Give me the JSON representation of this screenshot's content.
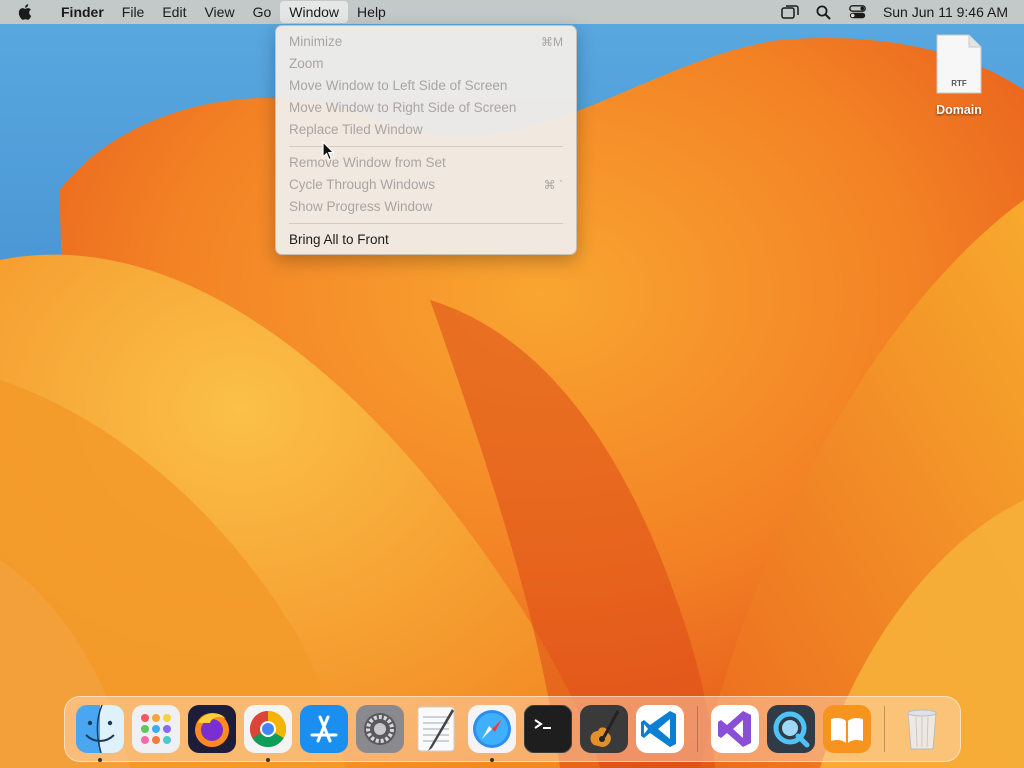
{
  "menubar": {
    "app_name": "Finder",
    "menus": [
      "File",
      "Edit",
      "View",
      "Go",
      "Window",
      "Help"
    ],
    "active_menu": "Window",
    "clock": "Sun Jun 11  9:46 AM",
    "status_icons": [
      "screen-mirroring-icon",
      "search-icon",
      "control-center-icon"
    ]
  },
  "window_menu": {
    "items": [
      {
        "label": "Minimize",
        "shortcut": "⌘M",
        "enabled": false
      },
      {
        "label": "Zoom",
        "shortcut": "",
        "enabled": false
      },
      {
        "label": "Move Window to Left Side of Screen",
        "shortcut": "",
        "enabled": false
      },
      {
        "label": "Move Window to Right Side of Screen",
        "shortcut": "",
        "enabled": false
      },
      {
        "label": "Replace Tiled Window",
        "shortcut": "",
        "enabled": false
      },
      {
        "label": "Remove Window from Set",
        "shortcut": "",
        "enabled": false
      },
      {
        "label": "Cycle Through Windows",
        "shortcut": "⌘ `",
        "enabled": false
      },
      {
        "label": "Show Progress Window",
        "shortcut": "",
        "enabled": false
      },
      {
        "label": "Bring All to Front",
        "shortcut": "",
        "enabled": true
      }
    ]
  },
  "desktop": {
    "file": {
      "name": "Domain",
      "type": "RTF"
    }
  },
  "dock": {
    "apps": [
      {
        "name": "finder-icon",
        "running": true
      },
      {
        "name": "launchpad-icon",
        "running": false
      },
      {
        "name": "firefox-icon",
        "running": false
      },
      {
        "name": "chrome-icon",
        "running": true
      },
      {
        "name": "app-store-icon",
        "running": false
      },
      {
        "name": "system-settings-icon",
        "running": false
      },
      {
        "name": "textedit-icon",
        "running": false
      },
      {
        "name": "safari-icon",
        "running": true
      },
      {
        "name": "terminal-icon",
        "running": false
      },
      {
        "name": "garageband-icon",
        "running": false
      },
      {
        "name": "vscode-icon",
        "running": false
      },
      {
        "name": "visual-studio-icon",
        "running": false
      },
      {
        "name": "quicktime-icon",
        "running": false
      },
      {
        "name": "books-icon",
        "running": false
      },
      {
        "name": "trash-icon",
        "running": false
      }
    ]
  },
  "colors": {
    "wallpaper_orange": "#f07a1e",
    "wallpaper_yellow": "#f7b733",
    "wallpaper_blue": "#3f86cc"
  }
}
